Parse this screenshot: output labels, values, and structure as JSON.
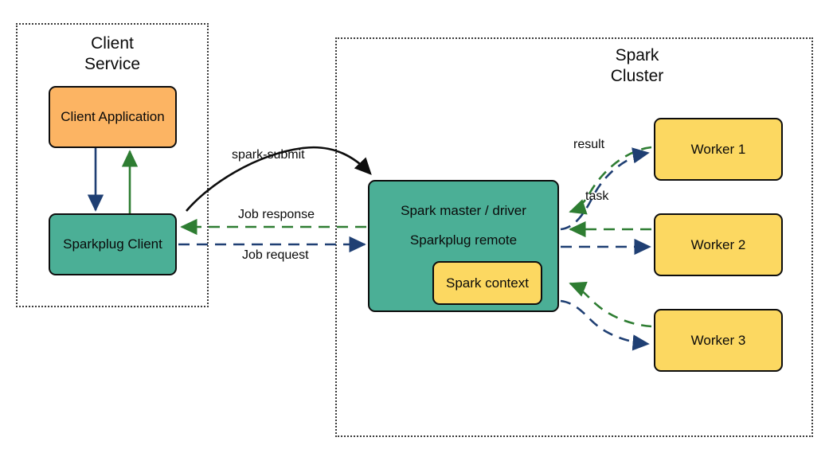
{
  "diagram": {
    "title_client": "Client\nService",
    "title_cluster": "Spark\nCluster",
    "colors": {
      "orange": "#FCB463",
      "teal": "#4BAF96",
      "yellow": "#FCD861",
      "stroke": "#0d0d0d",
      "green_arrow": "#2E7D32",
      "blue_arrow": "#1F3F73",
      "dotted": "#3a3a3a"
    }
  },
  "nodes": {
    "client_application": "Client Application",
    "sparkplug_client": "Sparkplug Client",
    "spark_master_line1": "Spark master / driver",
    "spark_master_line2": "Sparkplug remote",
    "spark_context": "Spark context",
    "worker1": "Worker 1",
    "worker2": "Worker 2",
    "worker3": "Worker 3"
  },
  "edge_labels": {
    "spark_submit": "spark-submit",
    "job_response": "Job response",
    "job_request": "Job request",
    "result": "result",
    "task": "task"
  }
}
